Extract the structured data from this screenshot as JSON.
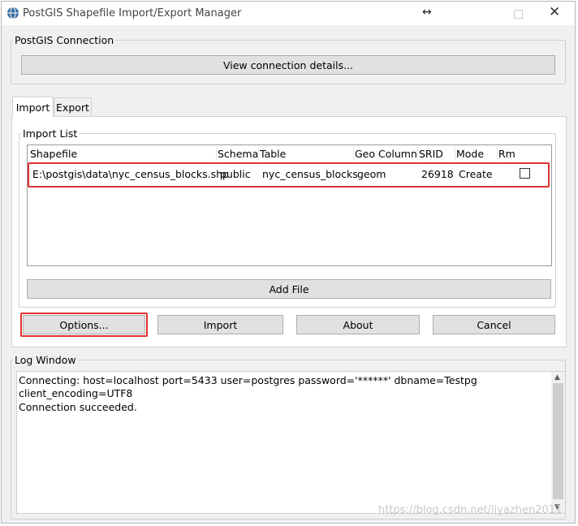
{
  "window": {
    "title": "PostGIS Shapefile Import/Export Manager",
    "resize_glyph": "↔",
    "close_glyph": "✕"
  },
  "connection": {
    "group_label": "PostGIS Connection",
    "view_button": "View connection details..."
  },
  "tabs": [
    {
      "label": "Import",
      "active": true
    },
    {
      "label": "Export",
      "active": false
    }
  ],
  "import_list": {
    "group_label": "Import List",
    "columns": [
      "Shapefile",
      "Schema",
      "Table",
      "Geo Column",
      "SRID",
      "Mode",
      "Rm"
    ],
    "rows": [
      {
        "shapefile": "E:\\postgis\\data\\nyc_census_blocks.shp",
        "schema": "public",
        "table": "nyc_census_blocks",
        "geo_column": "geom",
        "srid": "26918",
        "mode": "Create",
        "rm": false
      }
    ],
    "add_file_button": "Add File"
  },
  "actions": {
    "options": "Options...",
    "import": "Import",
    "about": "About",
    "cancel": "Cancel"
  },
  "log": {
    "group_label": "Log Window",
    "lines": [
      "Connecting:  host=localhost port=5433 user=postgres password='******' dbname=Testpg",
      "client_encoding=UTF8",
      "Connection succeeded."
    ]
  },
  "watermark": "https://blog.csdn.net/liyazhen2011",
  "colors": {
    "highlight": "#e03030",
    "window_bg": "#f0f0f0",
    "button_bg": "#e1e1e1"
  }
}
